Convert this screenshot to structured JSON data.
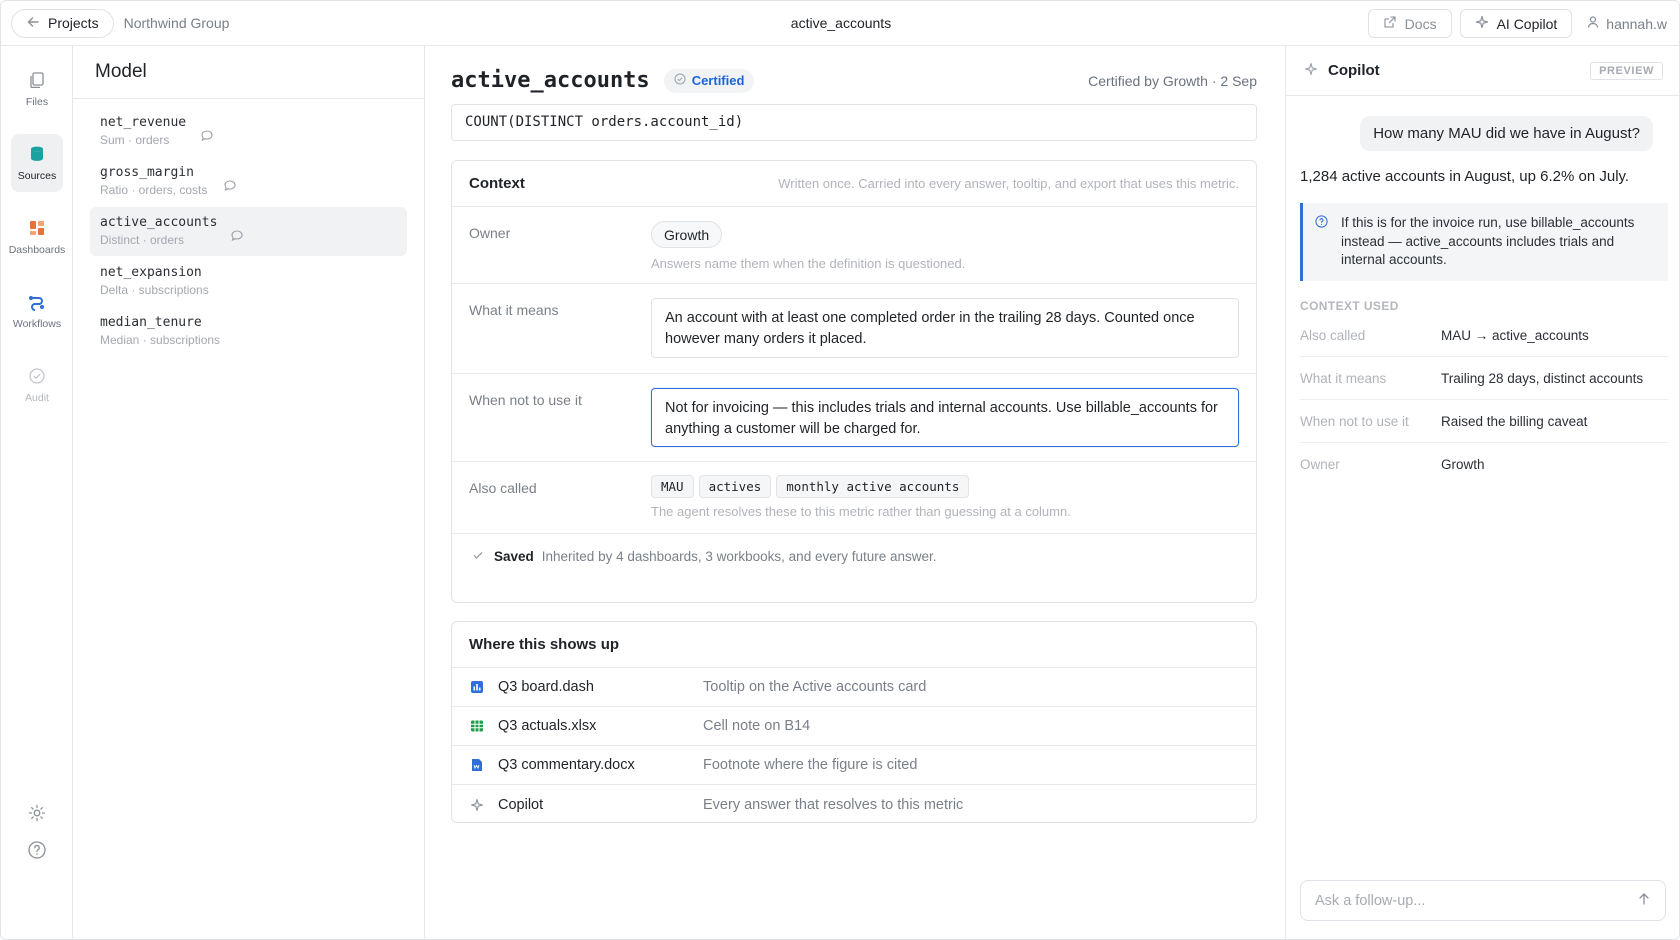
{
  "topbar": {
    "back_label": "Projects",
    "org": "Northwind Group",
    "title": "active_accounts",
    "docs_label": "Docs",
    "copilot_label": "AI Copilot",
    "user": "hannah.w"
  },
  "rail": {
    "files": "Files",
    "sources": "Sources",
    "dashboards": "Dashboards",
    "workflows": "Workflows",
    "audit": "Audit"
  },
  "model": {
    "heading": "Model",
    "items": [
      {
        "name": "net_revenue",
        "sub": "Sum · orders"
      },
      {
        "name": "gross_margin",
        "sub": "Ratio · orders, costs"
      },
      {
        "name": "active_accounts",
        "sub": "Distinct · orders"
      },
      {
        "name": "net_expansion",
        "sub": "Delta · subscriptions"
      },
      {
        "name": "median_tenure",
        "sub": "Median · subscriptions"
      }
    ]
  },
  "metric": {
    "title": "active_accounts",
    "badge": "Certified",
    "certified_meta": "Certified by Growth · 2 Sep",
    "formula": "COUNT(DISTINCT orders.account_id)"
  },
  "context": {
    "heading": "Context",
    "hint": "Written once. Carried into every answer, tooltip, and export that uses this metric.",
    "owner_label": "Owner",
    "owner_value": "Growth",
    "owner_note": "Answers name them when the definition is questioned.",
    "means_label": "What it means",
    "means_text": "An account with at least one completed order in the trailing 28 days. Counted once however many orders it placed.",
    "notuse_label": "When not to use it",
    "notuse_text": "Not for invoicing — this includes trials and internal accounts. Use billable_accounts for anything a customer will be charged for.",
    "also_label": "Also called",
    "aliases": [
      "MAU",
      "actives",
      "monthly active accounts"
    ],
    "also_note": "The agent resolves these to this metric rather than guessing at a column.",
    "saved_label": "Saved",
    "saved_desc": "Inherited by 4 dashboards, 3 workbooks, and every future answer."
  },
  "where": {
    "heading": "Where this shows up",
    "rows": [
      {
        "name": "Q3 board.dash",
        "desc": "Tooltip on the Active accounts card",
        "icon": "dashboard-icon",
        "color": "#2f6fd6"
      },
      {
        "name": "Q3 actuals.xlsx",
        "desc": "Cell note on B14",
        "icon": "spreadsheet-icon",
        "color": "#1e9e4a"
      },
      {
        "name": "Q3 commentary.docx",
        "desc": "Footnote where the figure is cited",
        "icon": "document-icon",
        "color": "#2f6fd6"
      },
      {
        "name": "Copilot",
        "desc": "Every answer that resolves to this metric",
        "icon": "sparkle-icon",
        "color": "#8a9099"
      }
    ]
  },
  "copilot": {
    "title": "Copilot",
    "preview": "PREVIEW",
    "question": "How many MAU did we have in August?",
    "answer": "1,284 active accounts in August, up 6.2% on July.",
    "caveat": "If this is for the invoice run, use billable_accounts instead — active_accounts includes trials and internal accounts.",
    "context_heading": "CONTEXT USED",
    "context_rows": [
      {
        "k": "Also called",
        "v": "MAU → active_accounts"
      },
      {
        "k": "What it means",
        "v": "Trailing 28 days, distinct accounts"
      },
      {
        "k": "When not to use it",
        "v": "Raised the billing caveat"
      },
      {
        "k": "Owner",
        "v": "Growth"
      }
    ],
    "ask_placeholder": "Ask a follow-up..."
  },
  "colors": {
    "accent": "#2f6fd6",
    "sources_icon": "#19a3a0",
    "dashboards_icon": "#e8703a",
    "workflows_icon": "#2f6fd6"
  }
}
